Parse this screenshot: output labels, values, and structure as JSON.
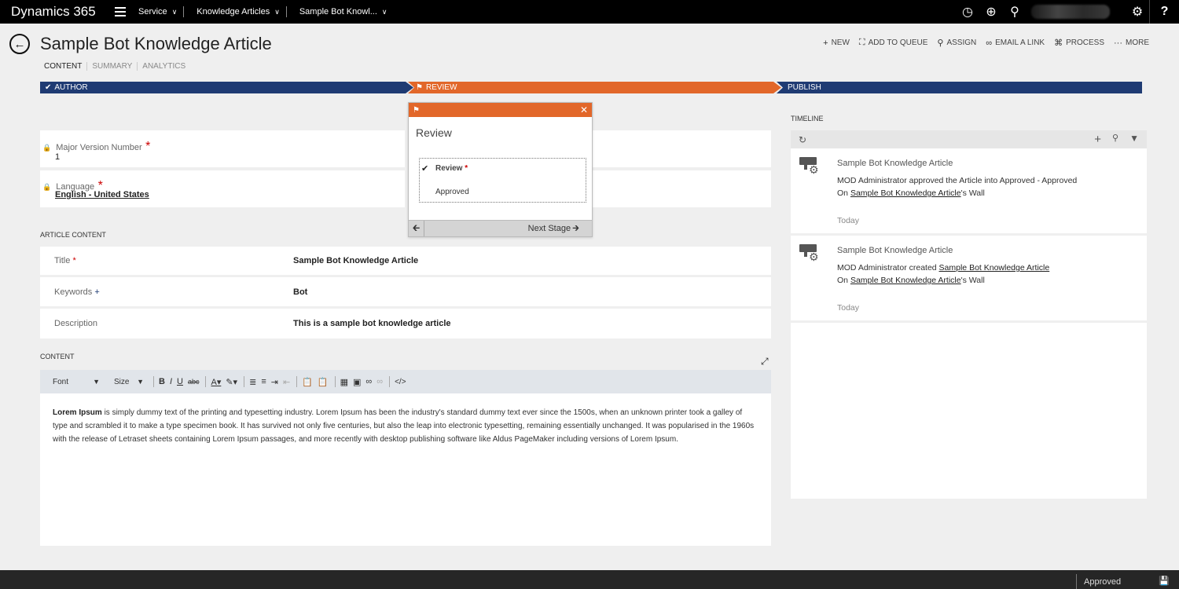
{
  "topbar": {
    "brand": "Dynamics 365",
    "nav": [
      "Service",
      "Knowledge Articles",
      "Sample Bot Knowl..."
    ],
    "help": "?"
  },
  "header": {
    "title": "Sample Bot Knowledge Article",
    "tabs": [
      "CONTENT",
      "SUMMARY",
      "ANALYTICS"
    ]
  },
  "commands": [
    {
      "icon": "+",
      "label": "NEW"
    },
    {
      "icon": "⛶",
      "label": "ADD TO QUEUE"
    },
    {
      "icon": "⚲",
      "label": "ASSIGN"
    },
    {
      "icon": "∞",
      "label": "EMAIL A LINK"
    },
    {
      "icon": "⌘",
      "label": "PROCESS"
    },
    {
      "icon": "···",
      "label": "MORE"
    }
  ],
  "process": {
    "stages": [
      "AUTHOR",
      "REVIEW",
      "PUBLISH"
    ],
    "colors": {
      "completed": "#1f3b73",
      "active": "#e2672a"
    }
  },
  "fields": {
    "major_version": {
      "label": "Major Version Number",
      "value": "1"
    },
    "language": {
      "label": "Language",
      "value": "English - United States"
    }
  },
  "article_content": {
    "heading": "ARTICLE CONTENT",
    "title_label": "Title",
    "title_value": "Sample Bot Knowledge Article",
    "keywords_label": "Keywords",
    "keywords_value": "Bot",
    "description_label": "Description",
    "description_value": "This is a sample bot knowledge article"
  },
  "content": {
    "heading": "CONTENT",
    "font_label": "Font",
    "size_label": "Size",
    "body_bold": "Lorem Ipsum",
    "body_rest": " is simply dummy text of the printing and typesetting industry. Lorem Ipsum has been the industry's standard dummy text ever since the 1500s, when an unknown printer took a galley of type and scrambled it to make a type specimen book. It has survived not only five centuries, but also the leap into electronic typesetting, remaining essentially unchanged. It was popularised in the 1960s with the release of Letraset sheets containing Lorem Ipsum passages, and more recently with desktop publishing software like Aldus PageMaker including versions of Lorem Ipsum."
  },
  "flyout": {
    "title": "Review",
    "steps": [
      "Review",
      "Approved"
    ],
    "next_label": "Next Stage"
  },
  "timeline": {
    "heading": "TIMELINE",
    "items": [
      {
        "title": "Sample Bot Knowledge Article",
        "line1_pre": "MOD Administrator approved the Article into Approved - Approved",
        "line1_link": "",
        "line2_pre": "On ",
        "line2_link": "Sample Bot Knowledge Article",
        "line2_post": "'s Wall",
        "date": "Today"
      },
      {
        "title": "Sample Bot Knowledge Article",
        "line1_pre": "MOD Administrator created ",
        "line1_link": "Sample Bot Knowledge Article",
        "line2_pre": "On ",
        "line2_link": "Sample Bot Knowledge Article",
        "line2_post": "'s Wall",
        "date": "Today"
      }
    ]
  },
  "footer": {
    "status": "Approved"
  }
}
